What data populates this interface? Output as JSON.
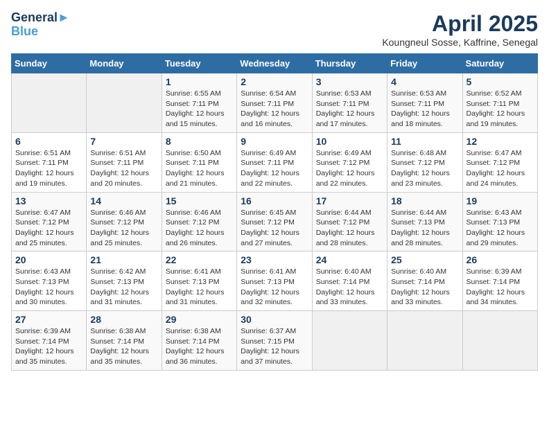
{
  "logo": {
    "line1": "General",
    "line2": "Blue"
  },
  "title": "April 2025",
  "subtitle": "Koungneul Sosse, Kaffrine, Senegal",
  "days_of_week": [
    "Sunday",
    "Monday",
    "Tuesday",
    "Wednesday",
    "Thursday",
    "Friday",
    "Saturday"
  ],
  "weeks": [
    [
      {
        "num": "",
        "sunrise": "",
        "sunset": "",
        "daylight": ""
      },
      {
        "num": "",
        "sunrise": "",
        "sunset": "",
        "daylight": ""
      },
      {
        "num": "1",
        "sunrise": "Sunrise: 6:55 AM",
        "sunset": "Sunset: 7:11 PM",
        "daylight": "Daylight: 12 hours and 15 minutes."
      },
      {
        "num": "2",
        "sunrise": "Sunrise: 6:54 AM",
        "sunset": "Sunset: 7:11 PM",
        "daylight": "Daylight: 12 hours and 16 minutes."
      },
      {
        "num": "3",
        "sunrise": "Sunrise: 6:53 AM",
        "sunset": "Sunset: 7:11 PM",
        "daylight": "Daylight: 12 hours and 17 minutes."
      },
      {
        "num": "4",
        "sunrise": "Sunrise: 6:53 AM",
        "sunset": "Sunset: 7:11 PM",
        "daylight": "Daylight: 12 hours and 18 minutes."
      },
      {
        "num": "5",
        "sunrise": "Sunrise: 6:52 AM",
        "sunset": "Sunset: 7:11 PM",
        "daylight": "Daylight: 12 hours and 19 minutes."
      }
    ],
    [
      {
        "num": "6",
        "sunrise": "Sunrise: 6:51 AM",
        "sunset": "Sunset: 7:11 PM",
        "daylight": "Daylight: 12 hours and 19 minutes."
      },
      {
        "num": "7",
        "sunrise": "Sunrise: 6:51 AM",
        "sunset": "Sunset: 7:11 PM",
        "daylight": "Daylight: 12 hours and 20 minutes."
      },
      {
        "num": "8",
        "sunrise": "Sunrise: 6:50 AM",
        "sunset": "Sunset: 7:11 PM",
        "daylight": "Daylight: 12 hours and 21 minutes."
      },
      {
        "num": "9",
        "sunrise": "Sunrise: 6:49 AM",
        "sunset": "Sunset: 7:11 PM",
        "daylight": "Daylight: 12 hours and 22 minutes."
      },
      {
        "num": "10",
        "sunrise": "Sunrise: 6:49 AM",
        "sunset": "Sunset: 7:12 PM",
        "daylight": "Daylight: 12 hours and 22 minutes."
      },
      {
        "num": "11",
        "sunrise": "Sunrise: 6:48 AM",
        "sunset": "Sunset: 7:12 PM",
        "daylight": "Daylight: 12 hours and 23 minutes."
      },
      {
        "num": "12",
        "sunrise": "Sunrise: 6:47 AM",
        "sunset": "Sunset: 7:12 PM",
        "daylight": "Daylight: 12 hours and 24 minutes."
      }
    ],
    [
      {
        "num": "13",
        "sunrise": "Sunrise: 6:47 AM",
        "sunset": "Sunset: 7:12 PM",
        "daylight": "Daylight: 12 hours and 25 minutes."
      },
      {
        "num": "14",
        "sunrise": "Sunrise: 6:46 AM",
        "sunset": "Sunset: 7:12 PM",
        "daylight": "Daylight: 12 hours and 25 minutes."
      },
      {
        "num": "15",
        "sunrise": "Sunrise: 6:46 AM",
        "sunset": "Sunset: 7:12 PM",
        "daylight": "Daylight: 12 hours and 26 minutes."
      },
      {
        "num": "16",
        "sunrise": "Sunrise: 6:45 AM",
        "sunset": "Sunset: 7:12 PM",
        "daylight": "Daylight: 12 hours and 27 minutes."
      },
      {
        "num": "17",
        "sunrise": "Sunrise: 6:44 AM",
        "sunset": "Sunset: 7:12 PM",
        "daylight": "Daylight: 12 hours and 28 minutes."
      },
      {
        "num": "18",
        "sunrise": "Sunrise: 6:44 AM",
        "sunset": "Sunset: 7:13 PM",
        "daylight": "Daylight: 12 hours and 28 minutes."
      },
      {
        "num": "19",
        "sunrise": "Sunrise: 6:43 AM",
        "sunset": "Sunset: 7:13 PM",
        "daylight": "Daylight: 12 hours and 29 minutes."
      }
    ],
    [
      {
        "num": "20",
        "sunrise": "Sunrise: 6:43 AM",
        "sunset": "Sunset: 7:13 PM",
        "daylight": "Daylight: 12 hours and 30 minutes."
      },
      {
        "num": "21",
        "sunrise": "Sunrise: 6:42 AM",
        "sunset": "Sunset: 7:13 PM",
        "daylight": "Daylight: 12 hours and 31 minutes."
      },
      {
        "num": "22",
        "sunrise": "Sunrise: 6:41 AM",
        "sunset": "Sunset: 7:13 PM",
        "daylight": "Daylight: 12 hours and 31 minutes."
      },
      {
        "num": "23",
        "sunrise": "Sunrise: 6:41 AM",
        "sunset": "Sunset: 7:13 PM",
        "daylight": "Daylight: 12 hours and 32 minutes."
      },
      {
        "num": "24",
        "sunrise": "Sunrise: 6:40 AM",
        "sunset": "Sunset: 7:14 PM",
        "daylight": "Daylight: 12 hours and 33 minutes."
      },
      {
        "num": "25",
        "sunrise": "Sunrise: 6:40 AM",
        "sunset": "Sunset: 7:14 PM",
        "daylight": "Daylight: 12 hours and 33 minutes."
      },
      {
        "num": "26",
        "sunrise": "Sunrise: 6:39 AM",
        "sunset": "Sunset: 7:14 PM",
        "daylight": "Daylight: 12 hours and 34 minutes."
      }
    ],
    [
      {
        "num": "27",
        "sunrise": "Sunrise: 6:39 AM",
        "sunset": "Sunset: 7:14 PM",
        "daylight": "Daylight: 12 hours and 35 minutes."
      },
      {
        "num": "28",
        "sunrise": "Sunrise: 6:38 AM",
        "sunset": "Sunset: 7:14 PM",
        "daylight": "Daylight: 12 hours and 35 minutes."
      },
      {
        "num": "29",
        "sunrise": "Sunrise: 6:38 AM",
        "sunset": "Sunset: 7:14 PM",
        "daylight": "Daylight: 12 hours and 36 minutes."
      },
      {
        "num": "30",
        "sunrise": "Sunrise: 6:37 AM",
        "sunset": "Sunset: 7:15 PM",
        "daylight": "Daylight: 12 hours and 37 minutes."
      },
      {
        "num": "",
        "sunrise": "",
        "sunset": "",
        "daylight": ""
      },
      {
        "num": "",
        "sunrise": "",
        "sunset": "",
        "daylight": ""
      },
      {
        "num": "",
        "sunrise": "",
        "sunset": "",
        "daylight": ""
      }
    ]
  ]
}
